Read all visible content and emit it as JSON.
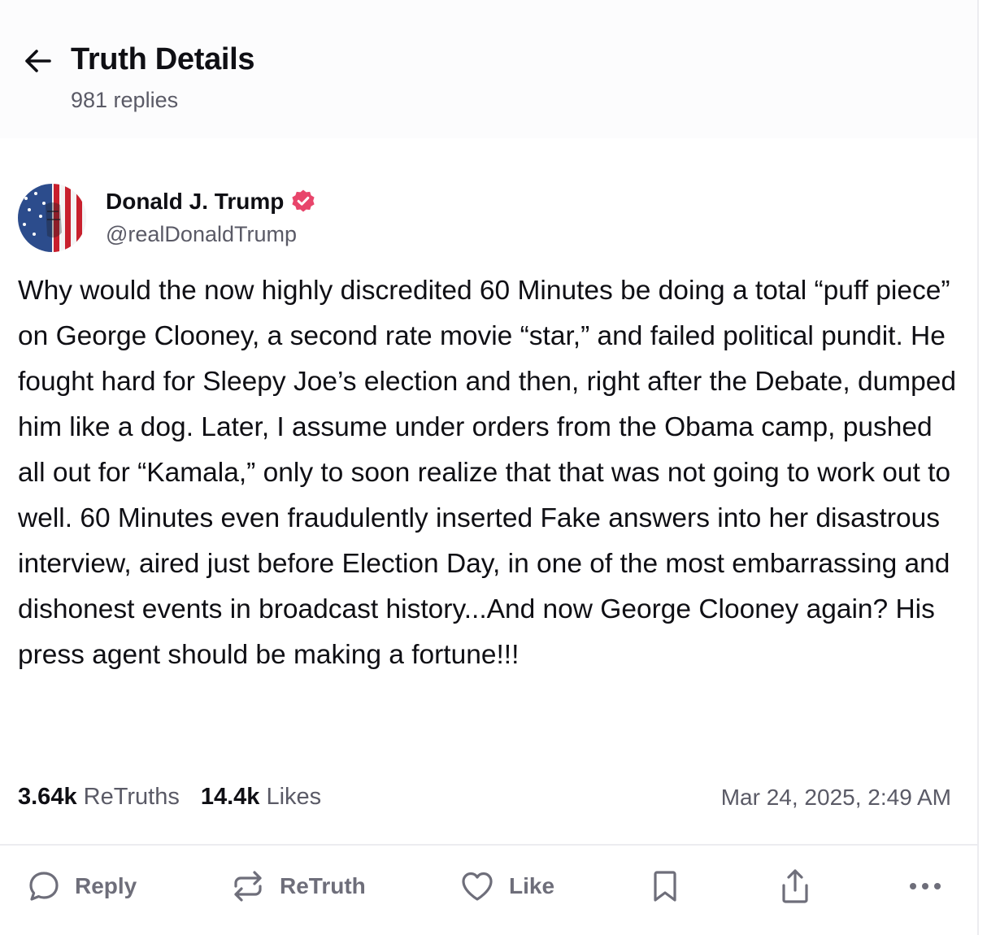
{
  "header": {
    "title": "Truth Details",
    "subtitle": "981 replies"
  },
  "author": {
    "name": "Donald J. Trump",
    "handle": "@realDonaldTrump",
    "verified": true
  },
  "post": {
    "text": "Why would the now highly discredited 60 Minutes be doing a total “puff piece” on George Clooney, a second rate movie “star,” and failed political pundit. He fought hard for Sleepy Joe’s election and then, right after the Debate, dumped him like a dog. Later, I assume under orders from the Obama camp, pushed all out for “Kamala,” only to soon realize that that was not going to work out to well. 60 Minutes even fraudulently inserted Fake answers into her disastrous interview, aired just before Election Day, in one of the most embarrassing and dishonest events in broadcast history...And now George Clooney again? His press agent should be making a fortune!!!"
  },
  "stats": {
    "retruths_count": "3.64k",
    "retruths_label": "ReTruths",
    "likes_count": "14.4k",
    "likes_label": "Likes",
    "timestamp": "Mar 24, 2025, 2:49 AM"
  },
  "actions": {
    "reply": "Reply",
    "retruth": "ReTruth",
    "like": "Like"
  },
  "colors": {
    "verified_badge": "#e8456b",
    "muted_text": "#5a5a66",
    "icon_gray": "#6e6e7a"
  },
  "icons": [
    "arrow-left-icon",
    "verified-badge-icon",
    "reply-bubble-icon",
    "retruth-repeat-icon",
    "heart-icon",
    "bookmark-icon",
    "share-icon",
    "more-dots-icon"
  ]
}
